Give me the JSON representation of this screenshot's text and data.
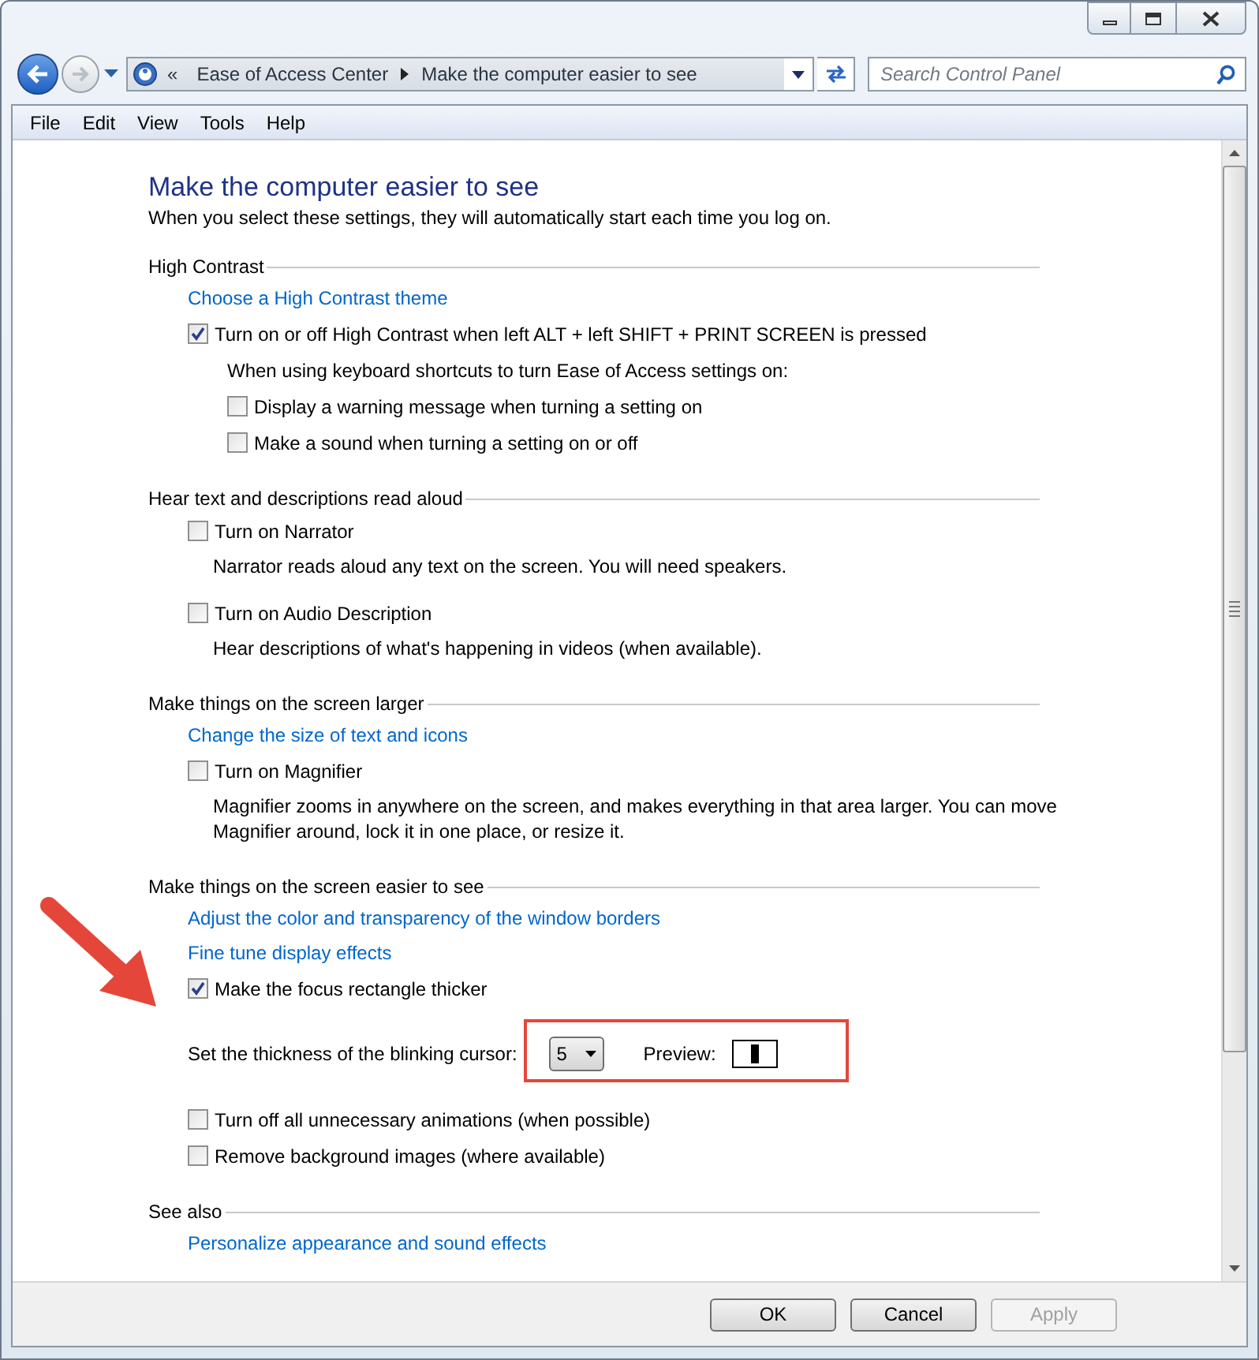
{
  "address_bar": {
    "overflow": "«",
    "crumbs": [
      "Ease of Access Center",
      "Make the computer easier to see"
    ]
  },
  "search": {
    "placeholder": "Search Control Panel"
  },
  "menu": [
    "File",
    "Edit",
    "View",
    "Tools",
    "Help"
  ],
  "page": {
    "title": "Make the computer easier to see",
    "subtitle": "When you select these settings, they will automatically start each time you log on."
  },
  "sections": [
    {
      "heading": "High Contrast",
      "items": [
        {
          "kind": "link",
          "text": "Choose a High Contrast theme"
        },
        {
          "kind": "checkbox",
          "label": "Turn on or off High Contrast when left ALT + left SHIFT + PRINT SCREEN is pressed",
          "checked": true,
          "children": [
            {
              "kind": "note",
              "text": "When using keyboard shortcuts to turn Ease of Access settings on:"
            },
            {
              "kind": "checkbox",
              "label": "Display a warning message when turning a setting on",
              "checked": false
            },
            {
              "kind": "checkbox",
              "label": "Make a sound when turning a setting on or off",
              "checked": false
            }
          ]
        }
      ]
    },
    {
      "heading": "Hear text and descriptions read aloud",
      "items": [
        {
          "kind": "checkbox",
          "label": "Turn on Narrator",
          "checked": false,
          "description": "Narrator reads aloud any text on the screen. You will need speakers."
        },
        {
          "kind": "checkbox",
          "label": "Turn on Audio Description",
          "checked": false,
          "description": "Hear descriptions of what's happening in videos (when available)."
        }
      ]
    },
    {
      "heading": "Make things on the screen larger",
      "items": [
        {
          "kind": "link",
          "text": "Change the size of text and icons"
        },
        {
          "kind": "checkbox",
          "label": "Turn on Magnifier",
          "checked": false,
          "description": "Magnifier zooms in anywhere on the screen, and makes everything in that area larger. You can move Magnifier around, lock it in one place, or resize it."
        }
      ]
    },
    {
      "heading": "Make things on the screen easier to see",
      "items": [
        {
          "kind": "link",
          "text": "Adjust the color and transparency of the window borders"
        },
        {
          "kind": "link",
          "text": "Fine tune display effects"
        },
        {
          "kind": "checkbox",
          "label": "Make the focus rectangle thicker",
          "checked": true
        },
        {
          "kind": "cursor_thickness",
          "label": "Set the thickness of the blinking cursor:",
          "value": "5",
          "preview_label": "Preview:"
        },
        {
          "kind": "checkbox",
          "label": "Turn off all unnecessary animations (when possible)",
          "checked": false
        },
        {
          "kind": "checkbox",
          "label": "Remove background images (where available)",
          "checked": false
        }
      ]
    },
    {
      "heading": "See also",
      "items": [
        {
          "kind": "link",
          "text": "Personalize appearance and sound effects"
        }
      ]
    }
  ],
  "buttons": [
    {
      "label": "OK",
      "disabled": false
    },
    {
      "label": "Cancel",
      "disabled": false
    },
    {
      "label": "Apply",
      "disabled": true
    }
  ]
}
